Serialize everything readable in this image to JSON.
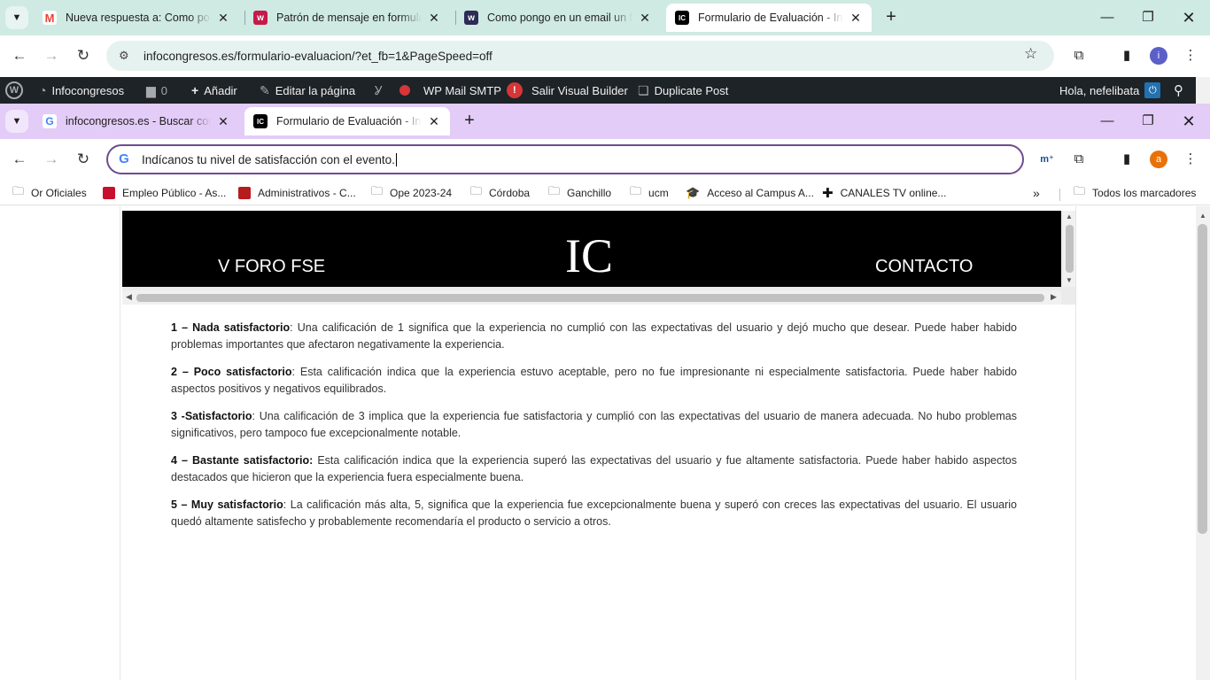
{
  "outer_browser": {
    "tabs": [
      {
        "title": "Nueva respuesta a: Como pong",
        "favicon_color": "#ea4335",
        "favicon_text": "M"
      },
      {
        "title": "Patrón de mensaje en formulari",
        "favicon_color": "#c51a4a",
        "favicon_text": "w"
      },
      {
        "title": "Como pongo en un email un fo",
        "favicon_color": "#2c2c54",
        "favicon_text": "w"
      },
      {
        "title": "Formulario de Evaluación - Info",
        "favicon_color": "#000000",
        "favicon_text": "IC"
      }
    ],
    "url": "infocongresos.es/formulario-evaluacion/?et_fb=1&PageSpeed=off",
    "avatar_letter": "i",
    "avatar_color": "#5b5fc7"
  },
  "wp_admin_bar": {
    "site": "Infocongresos",
    "comments_count": "0",
    "add": "Añadir",
    "edit_page": "Editar la página",
    "wp_mail_smtp": "WP Mail SMTP",
    "smtp_badge": "!",
    "exit_builder": "Salir Visual Builder",
    "duplicate_post": "Duplicate Post",
    "greeting": "Hola, nefelibata"
  },
  "inner_browser": {
    "tabs": [
      {
        "title": "infocongresos.es - Buscar con G",
        "favicon_color": "#ffffff",
        "favicon_text": "G"
      },
      {
        "title": "Formulario de Evaluación - Info",
        "favicon_color": "#000000",
        "favicon_text": "IC"
      }
    ],
    "omnibox_text": "Indícanos tu nivel de satisfacción con el evento.",
    "avatar_letter": "a",
    "avatar_color": "#e8710a",
    "bookmarks": [
      {
        "label": "Or Oficiales",
        "icon": "folder-icon"
      },
      {
        "label": "Empleo Público - As...",
        "icon": "square",
        "color": "#c8102e"
      },
      {
        "label": "Administrativos - C...",
        "icon": "square",
        "color": "#b71c1c"
      },
      {
        "label": "Ope 2023-24",
        "icon": "folder-icon"
      },
      {
        "label": "Córdoba",
        "icon": "folder-icon"
      },
      {
        "label": "Ganchillo",
        "icon": "folder-icon"
      },
      {
        "label": "ucm",
        "icon": "folder-icon"
      },
      {
        "label": "Acceso al Campus A...",
        "icon": "cap-icon"
      },
      {
        "label": "CANALES TV online...",
        "icon": "cross-icon"
      }
    ],
    "all_bookmarks": "Todos los marcadores"
  },
  "site_header": {
    "left_menu": "V FORO FSE",
    "logo": "IC",
    "right_menu": "CONTACTO"
  },
  "ratings": [
    {
      "label": "1 – Nada satisfactorio",
      "text": ": Una calificación de 1 significa que la experiencia no cumplió con las expectativas del usuario y dejó mucho que desear. Puede haber habido problemas importantes que afectaron negativamente la experiencia."
    },
    {
      "label": "2 – Poco satisfactorio",
      "text": ": Esta calificación indica que la experiencia estuvo aceptable, pero no fue impresionante ni especialmente satisfactoria. Puede haber habido aspectos positivos y negativos equilibrados."
    },
    {
      "label": "3 -Satisfactorio",
      "text": ": Una calificación de 3 implica que la experiencia fue satisfactoria y cumplió con las expectativas del usuario de manera adecuada. No hubo problemas significativos, pero tampoco fue excepcionalmente notable."
    },
    {
      "label": "4 – Bastante satisfactorio:",
      "text": " Esta calificación indica que la experiencia superó las expectativas del usuario y fue altamente satisfactoria. Puede haber habido aspectos destacados que hicieron que la experiencia fuera especialmente buena."
    },
    {
      "label": "5 – Muy satisfactorio",
      "text": ": La calificación más alta, 5, significa que la experiencia fue excepcionalmente buena y superó con creces las expectativas del usuario. El usuario quedó altamente satisfecho y probablemente recomendaría el producto o servicio a otros."
    }
  ]
}
